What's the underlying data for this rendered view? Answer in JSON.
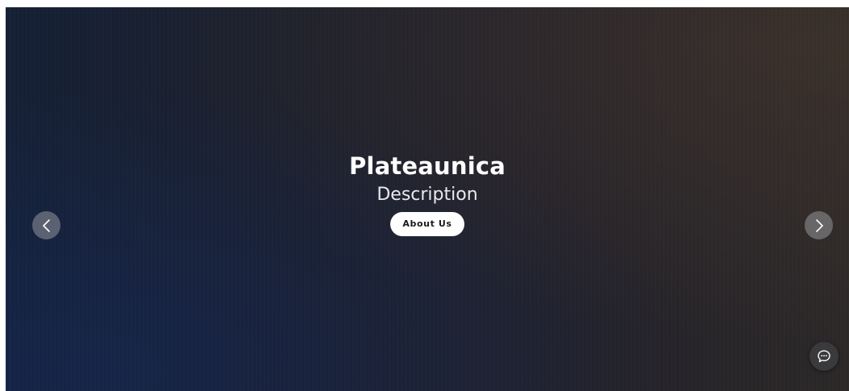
{
  "hero": {
    "title": "Plateaunica",
    "description": "Description",
    "cta_label": "About Us"
  },
  "carousel": {
    "prev_icon": "chevron-left-icon",
    "next_icon": "chevron-right-icon"
  },
  "chat": {
    "icon": "chat-bubble-icon"
  },
  "colors": {
    "cta_background": "#ffffff",
    "cta_text": "#1a1a1a",
    "title_text": "#ffffff"
  }
}
